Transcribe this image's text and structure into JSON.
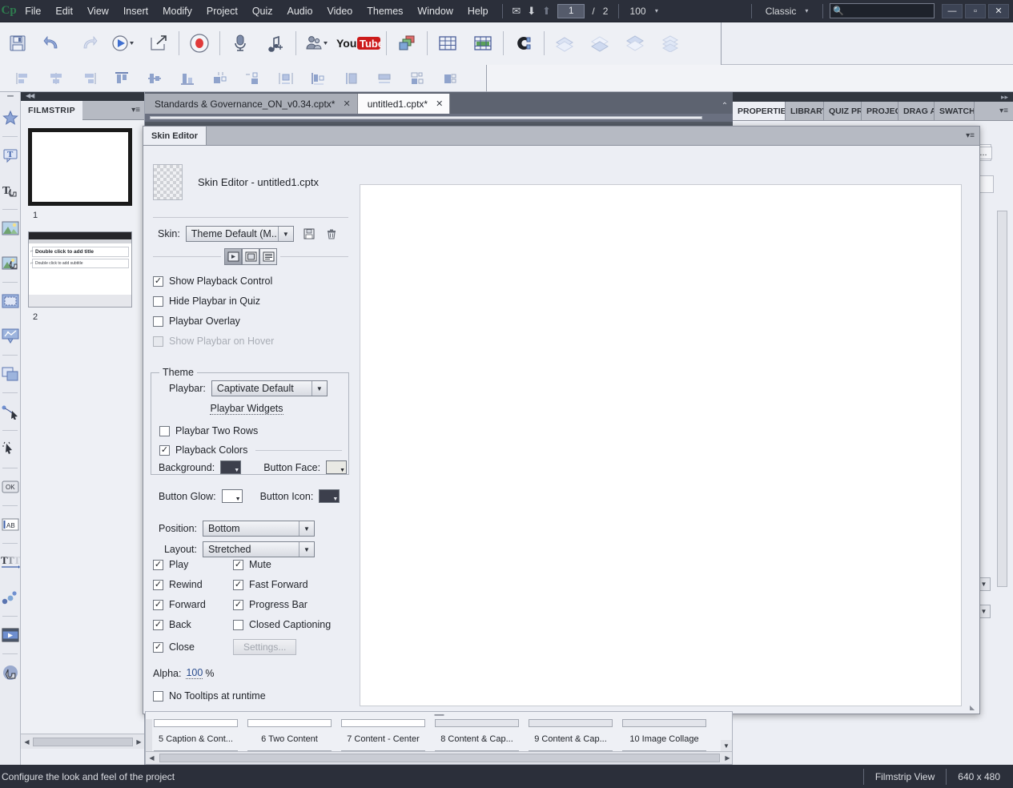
{
  "menubar": {
    "logo": "Cp",
    "items": [
      "File",
      "Edit",
      "View",
      "Insert",
      "Modify",
      "Project",
      "Quiz",
      "Audio",
      "Video",
      "Themes",
      "Window",
      "Help"
    ],
    "mail_icon": "mail-icon",
    "down_icon": "move-down-icon",
    "up_icon": "move-up-icon",
    "page_current": "1",
    "page_divider": "/",
    "page_total": "2",
    "zoom_value": "100",
    "zoom_caret": "▾",
    "workspace": "Classic",
    "workspace_caret": "▾",
    "search_placeholder": "",
    "search_value": "",
    "search_icon": "search-icon",
    "min_label": "—",
    "max_label": "▫",
    "close_label": "✕"
  },
  "toolbar": {
    "buttons": [
      {
        "name": "save-button",
        "label": "Save"
      },
      {
        "name": "undo-button",
        "label": "Undo"
      },
      {
        "name": "redo-button",
        "label": "Redo"
      },
      {
        "name": "preview-button",
        "label": "Preview"
      },
      {
        "name": "publish-button",
        "label": "Publish"
      },
      {
        "name": "record-button",
        "label": "Record"
      },
      {
        "name": "record-audio-button",
        "label": "Record Audio"
      },
      {
        "name": "add-audio-button",
        "label": "Audio"
      },
      {
        "name": "characters-button",
        "label": "Characters"
      },
      {
        "name": "youtube-button",
        "label": "YouTube"
      },
      {
        "name": "publish-to-button",
        "label": "Publish To"
      },
      {
        "name": "table-button",
        "label": "Table"
      },
      {
        "name": "grid-button",
        "label": "Grid"
      },
      {
        "name": "magnet-button",
        "label": "Magnet"
      },
      {
        "name": "layer1-button",
        "label": "Layer 1"
      },
      {
        "name": "layer2-button",
        "label": "Layer 2"
      },
      {
        "name": "layer3-button",
        "label": "Layer 3"
      },
      {
        "name": "layer4-button",
        "label": "Layer 4"
      }
    ],
    "align_buttons": [
      "align-left",
      "align-center-h",
      "align-right",
      "align-top",
      "align-middle",
      "align-bottom",
      "resize-same-width",
      "resize-same-height",
      "resize-same-size",
      "distribute-h",
      "distribute-v",
      "align-to-stage-h",
      "align-to-stage-v",
      "group-align"
    ]
  },
  "filmstrip": {
    "panel_title": "FILMSTRIP",
    "menu_icon": "panel-menu-icon",
    "slides": [
      {
        "number": "1",
        "title": "",
        "subtitle": "",
        "selected": true
      },
      {
        "number": "2",
        "title": "Double click to add title",
        "subtitle": "Double click to add subtitle",
        "selected": false
      }
    ]
  },
  "doctabs": {
    "tabs": [
      {
        "label": "Standards & Governance_ON_v0.34.cptx*",
        "close": "✕",
        "active": false
      },
      {
        "label": "untitled1.cptx*",
        "close": "✕",
        "active": true
      }
    ],
    "expand_icon": "chevron-down-icon"
  },
  "rightpanel": {
    "tabs": [
      {
        "label": "PROPERTIES",
        "active": true
      },
      {
        "label": "LIBRARY",
        "active": false
      },
      {
        "label": "QUIZ PR",
        "active": false
      },
      {
        "label": "PROJECT",
        "active": false
      },
      {
        "label": "DRAG A",
        "active": false
      },
      {
        "label": "SWATCH",
        "active": false
      }
    ],
    "menu_icon": "panel-menu-icon",
    "expand_icon": "expand-panels-icon",
    "collapse_label": "◀◀",
    "close_label": "✕",
    "overflow_label": "..."
  },
  "skin_editor": {
    "tab_label": "Skin Editor",
    "tab_menu_icon": "panel-menu-icon",
    "title": "Skin Editor - untitled1.cptx",
    "thumbnail_icon": "transparency-checker-thumbnail",
    "skin_label": "Skin:",
    "skin_value": "Theme Default (M..",
    "skin_save_icon": "save-icon",
    "skin_delete_icon": "trash-icon",
    "mode_buttons": [
      {
        "name": "playback-control-mode",
        "icon": "playbar-icon",
        "active": true
      },
      {
        "name": "borders-mode",
        "icon": "border-icon",
        "active": false
      },
      {
        "name": "toc-mode",
        "icon": "toc-icon",
        "active": false
      }
    ],
    "checkboxes_top": [
      {
        "label": "Show Playback Control",
        "checked": true,
        "disabled": false
      },
      {
        "label": "Hide Playbar in Quiz",
        "checked": false,
        "disabled": false
      },
      {
        "label": "Playbar Overlay",
        "checked": false,
        "disabled": false
      },
      {
        "label": "Show Playbar on Hover",
        "checked": false,
        "disabled": true
      }
    ],
    "theme_group": {
      "legend": "Theme",
      "playbar_label": "Playbar:",
      "playbar_value": "Captivate Default",
      "widgets_link": "Playbar Widgets",
      "two_rows": {
        "label": "Playbar Two Rows",
        "checked": false
      },
      "playback_colors": {
        "label": "Playback Colors",
        "checked": true
      },
      "colors": [
        {
          "label": "Background:",
          "value": "#3c3f4c",
          "name": "background-color-swatch"
        },
        {
          "label": "Button Face:",
          "value": "#e9e9e4",
          "name": "button-face-color-swatch"
        },
        {
          "label": "Button Glow:",
          "value": "#ffffff",
          "name": "button-glow-color-swatch"
        },
        {
          "label": "Button Icon:",
          "value": "#3c3f4c",
          "name": "button-icon-color-swatch"
        }
      ]
    },
    "position_label": "Position:",
    "position_value": "Bottom",
    "layout_label": "Layout:",
    "layout_value": "Stretched",
    "controls": [
      {
        "label": "Play",
        "checked": true
      },
      {
        "label": "Mute",
        "checked": true
      },
      {
        "label": "Rewind",
        "checked": true
      },
      {
        "label": "Fast Forward",
        "checked": true
      },
      {
        "label": "Forward",
        "checked": true
      },
      {
        "label": "Progress Bar",
        "checked": true
      },
      {
        "label": "Back",
        "checked": true
      },
      {
        "label": "Closed Captioning",
        "checked": false
      },
      {
        "label": "Close",
        "checked": true
      }
    ],
    "settings_button": "Settings...",
    "alpha_label": "Alpha:",
    "alpha_value": "100",
    "alpha_unit": "%",
    "no_tooltips": {
      "label": "No Tooltips at runtime",
      "checked": false
    },
    "resize_icon": "resize-grip-icon"
  },
  "template_strip": {
    "grip_icon": "drag-grip-icon",
    "items": [
      "5 Caption & Cont...",
      "6 Two Content",
      "7 Content - Center",
      "8 Content & Cap...",
      "9 Content & Cap...",
      "10 Image Collage"
    ],
    "scroll_left": "◀",
    "scroll_right": "▶",
    "scroll_down": "▼"
  },
  "left_tools": [
    {
      "name": "shape-tool",
      "icon": "star-icon"
    },
    {
      "name": "text-caption-tool",
      "icon": "text-balloon-icon"
    },
    {
      "name": "rollover-caption-tool",
      "icon": "text-hand-icon"
    },
    {
      "name": "image-tool",
      "icon": "image-icon"
    },
    {
      "name": "rollover-image-tool",
      "icon": "image-hand-icon"
    },
    {
      "name": "highlight-box-tool",
      "icon": "dashed-rect-icon"
    },
    {
      "name": "zoom-area-tool",
      "icon": "zoom-area-icon"
    },
    {
      "name": "rollover-slidelet-tool",
      "icon": "slidelet-icon"
    },
    {
      "name": "mouse-tool",
      "icon": "mouse-pointer-icon"
    },
    {
      "name": "click-box-tool",
      "icon": "click-box-icon"
    },
    {
      "name": "button-tool",
      "icon": "ok-button-icon"
    },
    {
      "name": "text-entry-box-tool",
      "icon": "text-entry-icon"
    },
    {
      "name": "typing-animation-tool",
      "icon": "typing-text-icon"
    },
    {
      "name": "animation-tool",
      "icon": "animation-bubbles-icon"
    },
    {
      "name": "video-tool",
      "icon": "video-filmstrip-icon"
    },
    {
      "name": "interaction-tool",
      "icon": "hand-touch-icon"
    }
  ],
  "statusbar": {
    "message": "Configure the look and feel of the project",
    "view_mode": "Filmstrip View",
    "dimensions": "640 x 480"
  }
}
